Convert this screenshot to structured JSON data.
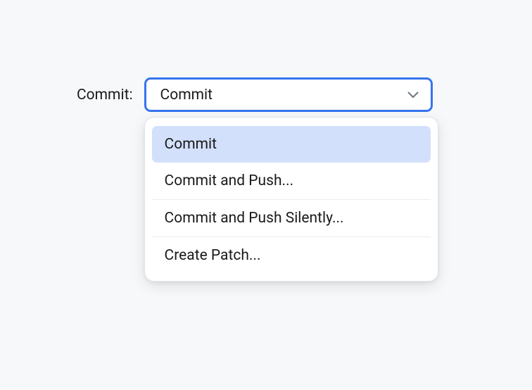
{
  "form": {
    "label": "Commit:"
  },
  "dropdown": {
    "selected": "Commit",
    "items": [
      {
        "label": "Commit"
      },
      {
        "label": "Commit and Push..."
      },
      {
        "label": "Commit and Push Silently..."
      },
      {
        "label": "Create Patch..."
      }
    ]
  }
}
